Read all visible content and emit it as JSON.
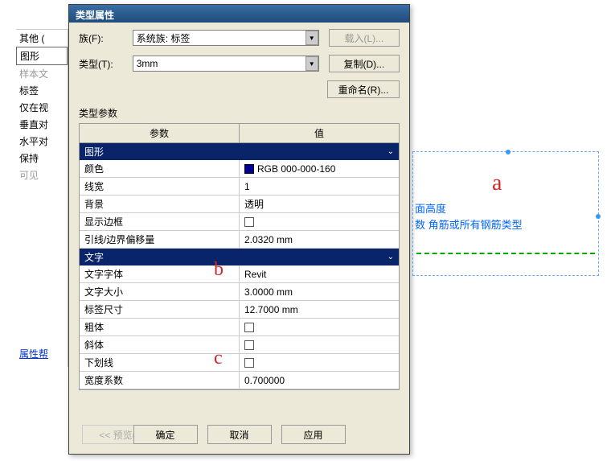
{
  "bg": {
    "items": [
      "其他 (",
      "图形",
      "样本文",
      "标签",
      "仅在视",
      "垂直对",
      "水平对",
      "保持",
      "可见"
    ],
    "help": "属性帮"
  },
  "dialog": {
    "title": "类型属性",
    "family_lbl": "族(F):",
    "family_val": "系统族: 标签",
    "type_lbl": "类型(T):",
    "type_val": "3mm",
    "load_btn": "载入(L)...",
    "copy_btn": "复制(D)...",
    "rename_btn": "重命名(R)...",
    "params_lbl": "类型参数",
    "col_param": "参数",
    "col_value": "值",
    "groups": [
      {
        "name": "图形",
        "rows": [
          {
            "p": "颜色",
            "v": "RGB 000-000-160",
            "swatch": true
          },
          {
            "p": "线宽",
            "v": "1"
          },
          {
            "p": "背景",
            "v": "透明"
          },
          {
            "p": "显示边框",
            "v": "",
            "chk": true
          },
          {
            "p": "引线/边界偏移量",
            "v": "2.0320 mm"
          }
        ]
      },
      {
        "name": "文字",
        "rows": [
          {
            "p": "文字字体",
            "v": "Revit"
          },
          {
            "p": "文字大小",
            "v": "3.0000 mm"
          },
          {
            "p": "标签尺寸",
            "v": "12.7000 mm"
          },
          {
            "p": "粗体",
            "v": "",
            "chk": true
          },
          {
            "p": "斜体",
            "v": "",
            "chk": true
          },
          {
            "p": "下划线",
            "v": "",
            "chk": true
          },
          {
            "p": "宽度系数",
            "v": "0.700000"
          }
        ]
      }
    ],
    "preview_btn": "<< 预览(P)",
    "ok_btn": "确定",
    "cancel_btn": "取消",
    "apply_btn": "应用"
  },
  "annotations": {
    "a": "a",
    "b": "b",
    "c": "c"
  },
  "right_panel": {
    "line1": "面高度",
    "line2": "数 角筋或所有钢筋类型"
  }
}
